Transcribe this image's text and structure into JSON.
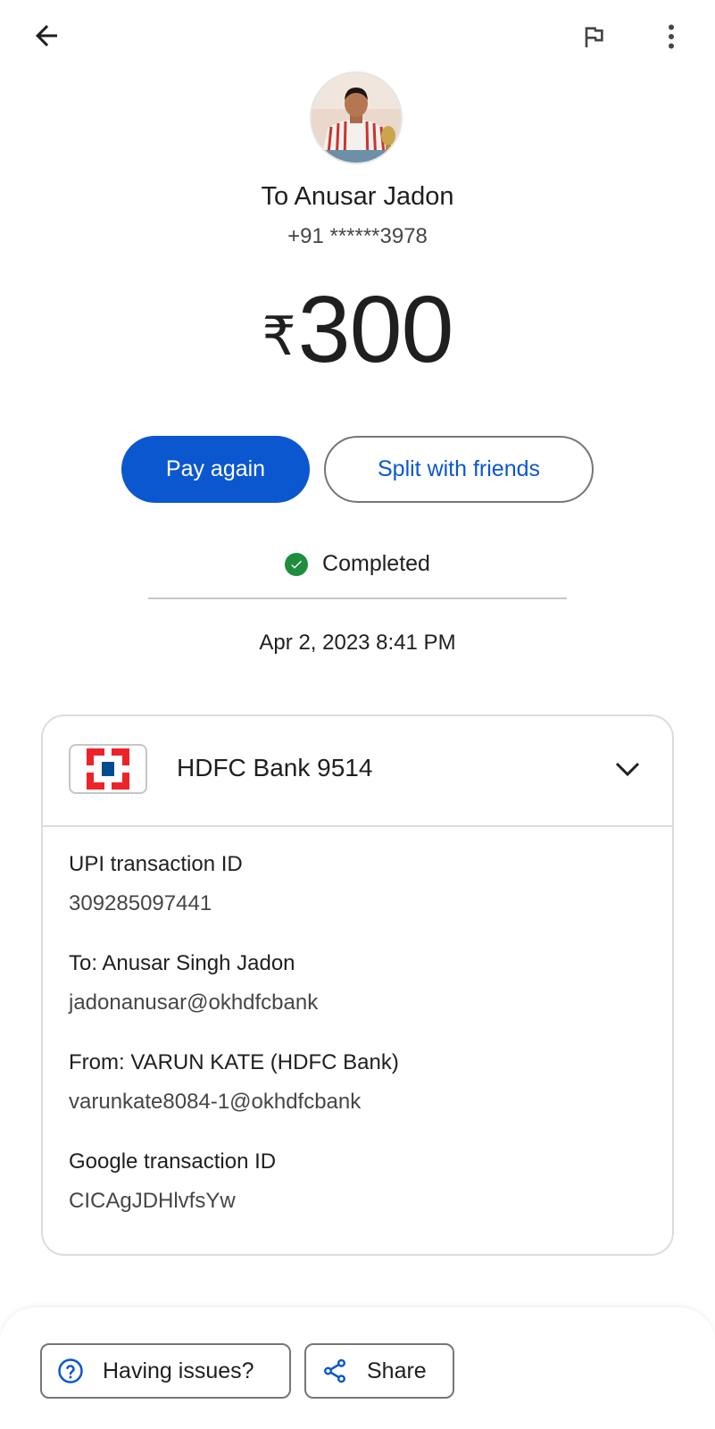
{
  "header": {
    "back_icon": "arrow-left-icon",
    "flag_icon": "flag-icon",
    "more_icon": "more-vert-icon"
  },
  "recipient": {
    "title": "To Anusar Jadon",
    "phone": "+91 ******3978",
    "avatar": "profile-photo"
  },
  "payment": {
    "currency": "₹",
    "amount": "300"
  },
  "actions": {
    "pay_again": "Pay again",
    "split": "Split with friends"
  },
  "status": {
    "label": "Completed",
    "datetime": "Apr 2, 2023 8:41 PM",
    "color": "#1e8e3e"
  },
  "account": {
    "bank": "HDFC Bank 9514",
    "logo": "hdfc-logo"
  },
  "details": [
    {
      "label": "UPI transaction ID",
      "value": "309285097441"
    },
    {
      "label": "To: Anusar Singh Jadon",
      "value": "jadonanusar@okhdfcbank"
    },
    {
      "label": "From: VARUN KATE (HDFC Bank)",
      "value": "varunkate8084-1@okhdfcbank"
    },
    {
      "label": "Google transaction ID",
      "value": "CICAgJDHlvfsYw"
    }
  ],
  "footer": {
    "issues": "Having issues?",
    "share": "Share",
    "issues_icon": "help-circle-icon",
    "share_icon": "share-icon"
  },
  "colors": {
    "primary": "#0b57d0",
    "hdfc_red": "#ed232a",
    "hdfc_blue": "#004c8f"
  }
}
